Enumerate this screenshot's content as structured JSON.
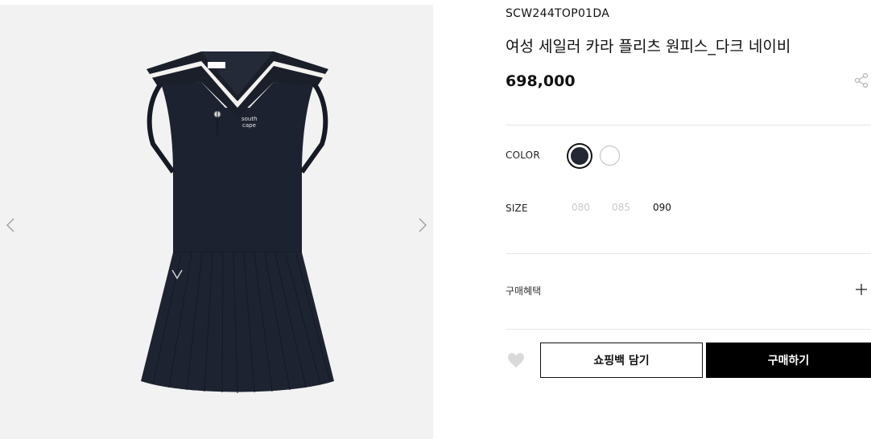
{
  "gallery": {
    "prev_icon": "chevron-left-icon",
    "next_icon": "chevron-right-icon",
    "image": "sailor-collar-pleated-dress"
  },
  "product": {
    "sku": "SCW244TOP01DA",
    "name": "여성 세일러 카라 플리츠 원피스_다크 네이비",
    "price": "698,000",
    "share_icon": "share-icon"
  },
  "options": {
    "color_label": "COLOR",
    "colors": [
      {
        "name": "navy",
        "hex": "#232833",
        "selected": true
      },
      {
        "name": "white",
        "hex": "#ffffff",
        "selected": false
      }
    ],
    "size_label": "SIZE",
    "sizes": [
      {
        "label": "080",
        "available": false
      },
      {
        "label": "085",
        "available": false
      },
      {
        "label": "090",
        "available": true
      }
    ]
  },
  "benefit": {
    "label": "구매혜택",
    "icon": "plus-icon"
  },
  "actions": {
    "wishlist_icon": "heart-icon",
    "cart_label": "쇼핑백 담기",
    "buy_label": "구매하기"
  },
  "colors": {
    "accent": "#000000",
    "divider": "#e6e6e6",
    "disabled_text": "#c9c9c9"
  }
}
